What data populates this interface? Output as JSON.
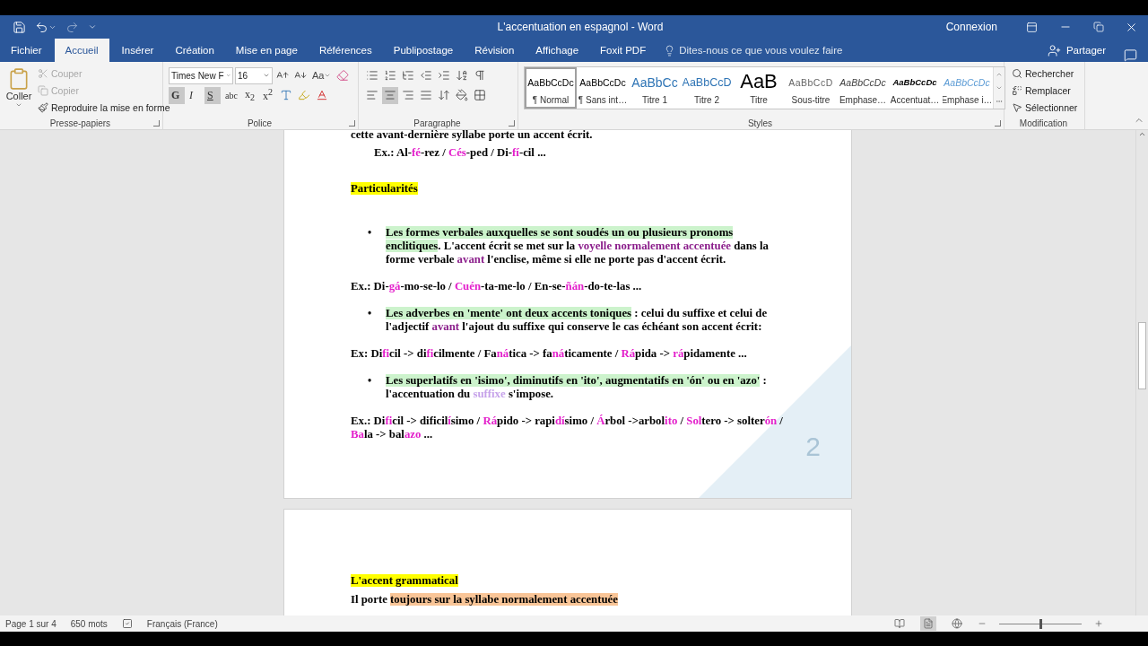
{
  "window": {
    "title": "L'accentuation en espagnol - Word",
    "account": "Connexion"
  },
  "tabs": [
    {
      "label": "Fichier",
      "selected": false
    },
    {
      "label": "Accueil",
      "selected": true
    },
    {
      "label": "Insérer",
      "selected": false
    },
    {
      "label": "Création",
      "selected": false
    },
    {
      "label": "Mise en page",
      "selected": false
    },
    {
      "label": "Références",
      "selected": false
    },
    {
      "label": "Publipostage",
      "selected": false
    },
    {
      "label": "Révision",
      "selected": false
    },
    {
      "label": "Affichage",
      "selected": false
    },
    {
      "label": "Foxit PDF",
      "selected": false
    }
  ],
  "tell_me": {
    "placeholder": "Dites-nous ce que vous voulez faire"
  },
  "share": "Partager",
  "ribbon": {
    "clipboard": {
      "label": "Presse-papiers",
      "paste": "Coller",
      "items": [
        {
          "kind": "cut",
          "label": "Couper",
          "disabled": true
        },
        {
          "kind": "copy",
          "label": "Copier",
          "disabled": true
        },
        {
          "kind": "format-painter",
          "label": "Reproduire la mise en forme",
          "disabled": false
        }
      ]
    },
    "font": {
      "label": "Police",
      "font_name": "Times New F",
      "font_size": "16",
      "case_button": "Aa",
      "buttons": [
        {
          "kind": "bold",
          "label": "G",
          "active": true
        },
        {
          "kind": "italic",
          "label": "I",
          "active": false
        },
        {
          "kind": "underline",
          "label": "S",
          "active": true
        },
        {
          "kind": "strike",
          "label": "abc",
          "active": false
        },
        {
          "kind": "sub",
          "label": "x$_{2}$",
          "active": false
        },
        {
          "kind": "sup",
          "label": "x$^{2}$",
          "active": false
        }
      ]
    },
    "paragraph": {
      "label": "Paragraphe",
      "align": [
        {
          "kind": "left",
          "selected": false
        },
        {
          "kind": "center",
          "selected": true
        },
        {
          "kind": "right",
          "selected": false
        },
        {
          "kind": "justify",
          "selected": false
        }
      ]
    },
    "styles": {
      "label": "Styles",
      "items": [
        {
          "kind": "normal",
          "preview": "AaBbCcDc",
          "name": "¶ Normal",
          "selected": true
        },
        {
          "kind": "normal",
          "preview": "AaBbCcDc",
          "name": "¶ Sans int…",
          "selected": false
        },
        {
          "kind": "heading1",
          "preview": "AaBbCc",
          "name": "Titre 1",
          "selected": false
        },
        {
          "kind": "heading2",
          "preview": "AaBbCcD",
          "name": "Titre 2",
          "selected": false
        },
        {
          "kind": "title",
          "preview": "AaB",
          "name": "Titre",
          "selected": false
        },
        {
          "kind": "subtitle",
          "preview": "AaBbCcD",
          "name": "Sous-titre",
          "selected": false
        },
        {
          "kind": "emphasis",
          "preview": "AaBbCcDc",
          "name": "Emphase…",
          "selected": false
        },
        {
          "kind": "strong-emphasis",
          "preview": "AaBbCcDc",
          "name": "Accentuat…",
          "selected": false
        },
        {
          "kind": "intense",
          "preview": "AaBbCcDc",
          "name": "Emphase i…",
          "selected": false
        }
      ]
    },
    "editing": {
      "label": "Modification",
      "items": [
        {
          "kind": "find",
          "label": "Rechercher"
        },
        {
          "kind": "replace",
          "label": "Remplacer"
        },
        {
          "kind": "select",
          "label": "Sélectionner"
        }
      ]
    }
  },
  "pages": [
    {
      "corner_number": "2",
      "paragraphs": [
        {
          "kind": "body",
          "runs": [
            {
              "kind": "plain",
              "text": "cette avant-dernière syllabe porte un accent écrit."
            }
          ]
        },
        {
          "kind": "example",
          "runs": [
            {
              "kind": "plain",
              "text": "Ex.: Al-"
            },
            {
              "kind": "accent",
              "text": "fé"
            },
            {
              "kind": "plain",
              "text": "-rez / "
            },
            {
              "kind": "accent",
              "text": "Cés"
            },
            {
              "kind": "plain",
              "text": "-ped / Di-"
            },
            {
              "kind": "accent",
              "text": "fí"
            },
            {
              "kind": "plain",
              "text": "-cil ..."
            }
          ]
        },
        {
          "kind": "heading",
          "runs": [
            {
              "kind": "yellow",
              "text": "Particularités"
            }
          ]
        },
        {
          "kind": "bullet",
          "marker": "•",
          "runs": [
            {
              "kind": "green",
              "text": "Les formes verbales auxquelles se sont soudés un ou plusieurs pronoms enclitiques"
            },
            {
              "kind": "plain",
              "text": ".  L'accent écrit se met sur la "
            },
            {
              "kind": "purple",
              "text": "voyelle normalement accentuée"
            },
            {
              "kind": "plain",
              "text": " dans la forme verbale "
            },
            {
              "kind": "purple",
              "text": "avant"
            },
            {
              "kind": "plain",
              "text": " l'enclise, même si elle ne porte pas d'accent écrit."
            }
          ]
        },
        {
          "kind": "body",
          "runs": [
            {
              "kind": "plain",
              "text": "Ex.: Di-"
            },
            {
              "kind": "accent",
              "text": "gá"
            },
            {
              "kind": "plain",
              "text": "-mo-se-lo / "
            },
            {
              "kind": "accent",
              "text": "Cuén"
            },
            {
              "kind": "plain",
              "text": "-ta-me-lo / En-se-"
            },
            {
              "kind": "accent",
              "text": "ñán"
            },
            {
              "kind": "plain",
              "text": "-do-te-las ..."
            }
          ]
        },
        {
          "kind": "bullet",
          "marker": "•",
          "runs": [
            {
              "kind": "green",
              "text": "Les adverbes en 'mente' ont deux accents toniques"
            },
            {
              "kind": "plain",
              "text": " : celui du suffixe et celui de l'adjectif "
            },
            {
              "kind": "purple",
              "text": "avant"
            },
            {
              "kind": "plain",
              "text": " l'ajout du suffixe qui conserve le cas échéant son accent écrit:"
            }
          ]
        },
        {
          "kind": "body",
          "runs": [
            {
              "kind": "plain",
              "text": "Ex: Di"
            },
            {
              "kind": "accent",
              "text": "fi"
            },
            {
              "kind": "plain",
              "text": "cil -> di"
            },
            {
              "kind": "accent",
              "text": "fi"
            },
            {
              "kind": "plain",
              "text": "cilmente / Fa"
            },
            {
              "kind": "accent",
              "text": "ná"
            },
            {
              "kind": "plain",
              "text": "tica -> fa"
            },
            {
              "kind": "accent",
              "text": "ná"
            },
            {
              "kind": "plain",
              "text": "ticamente / "
            },
            {
              "kind": "accent",
              "text": "Rá"
            },
            {
              "kind": "plain",
              "text": "pida -> "
            },
            {
              "kind": "accent",
              "text": "rá"
            },
            {
              "kind": "plain",
              "text": "pidamente ..."
            }
          ]
        },
        {
          "kind": "bullet",
          "marker": "•",
          "runs": [
            {
              "kind": "green",
              "text": "Les superlatifs en 'isimo', diminutifs en 'ito', augmentatifs en 'ón' ou en 'azo'"
            },
            {
              "kind": "plain",
              "text": " : l'accentuation du "
            },
            {
              "kind": "light",
              "text": "suffixe"
            },
            {
              "kind": "plain",
              "text": " s'impose."
            }
          ]
        },
        {
          "kind": "body",
          "runs": [
            {
              "kind": "plain",
              "text": "Ex.: Di"
            },
            {
              "kind": "accent",
              "text": "fi"
            },
            {
              "kind": "plain",
              "text": "cil -> dificil"
            },
            {
              "kind": "accent",
              "text": "í"
            },
            {
              "kind": "plain",
              "text": "simo / "
            },
            {
              "kind": "accent",
              "text": "Rá"
            },
            {
              "kind": "plain",
              "text": "pido -> rapi"
            },
            {
              "kind": "accent",
              "text": "dí"
            },
            {
              "kind": "plain",
              "text": "simo / "
            },
            {
              "kind": "accent",
              "text": "Á"
            },
            {
              "kind": "plain",
              "text": "rbol ->arbol"
            },
            {
              "kind": "accent",
              "text": "ito"
            },
            {
              "kind": "plain",
              "text": " / "
            },
            {
              "kind": "accent",
              "text": "Sol"
            },
            {
              "kind": "plain",
              "text": "tero -> solter"
            },
            {
              "kind": "accent",
              "text": "ón"
            },
            {
              "kind": "plain",
              "text": " / "
            },
            {
              "kind": "accent",
              "text": "Ba"
            },
            {
              "kind": "plain",
              "text": "la -> bal"
            },
            {
              "kind": "accent",
              "text": "azo"
            },
            {
              "kind": "plain",
              "text": " ..."
            }
          ]
        }
      ]
    },
    {
      "paragraphs": [
        {
          "kind": "heading",
          "runs": [
            {
              "kind": "yellow",
              "text": "L'accent grammatical"
            }
          ]
        },
        {
          "kind": "body",
          "runs": [
            {
              "kind": "plain",
              "text": "Il porte "
            },
            {
              "kind": "orange",
              "text": "toujours sur la syllabe normalement accentuée"
            }
          ]
        }
      ]
    }
  ],
  "status_bar": {
    "page": "Page 1 sur 4",
    "words": "650 mots",
    "language": "Français (France)",
    "views": [
      {
        "kind": "read",
        "selected": false
      },
      {
        "kind": "print",
        "selected": true
      },
      {
        "kind": "web",
        "selected": false
      }
    ],
    "zoom": {
      "level": 0.5
    }
  }
}
